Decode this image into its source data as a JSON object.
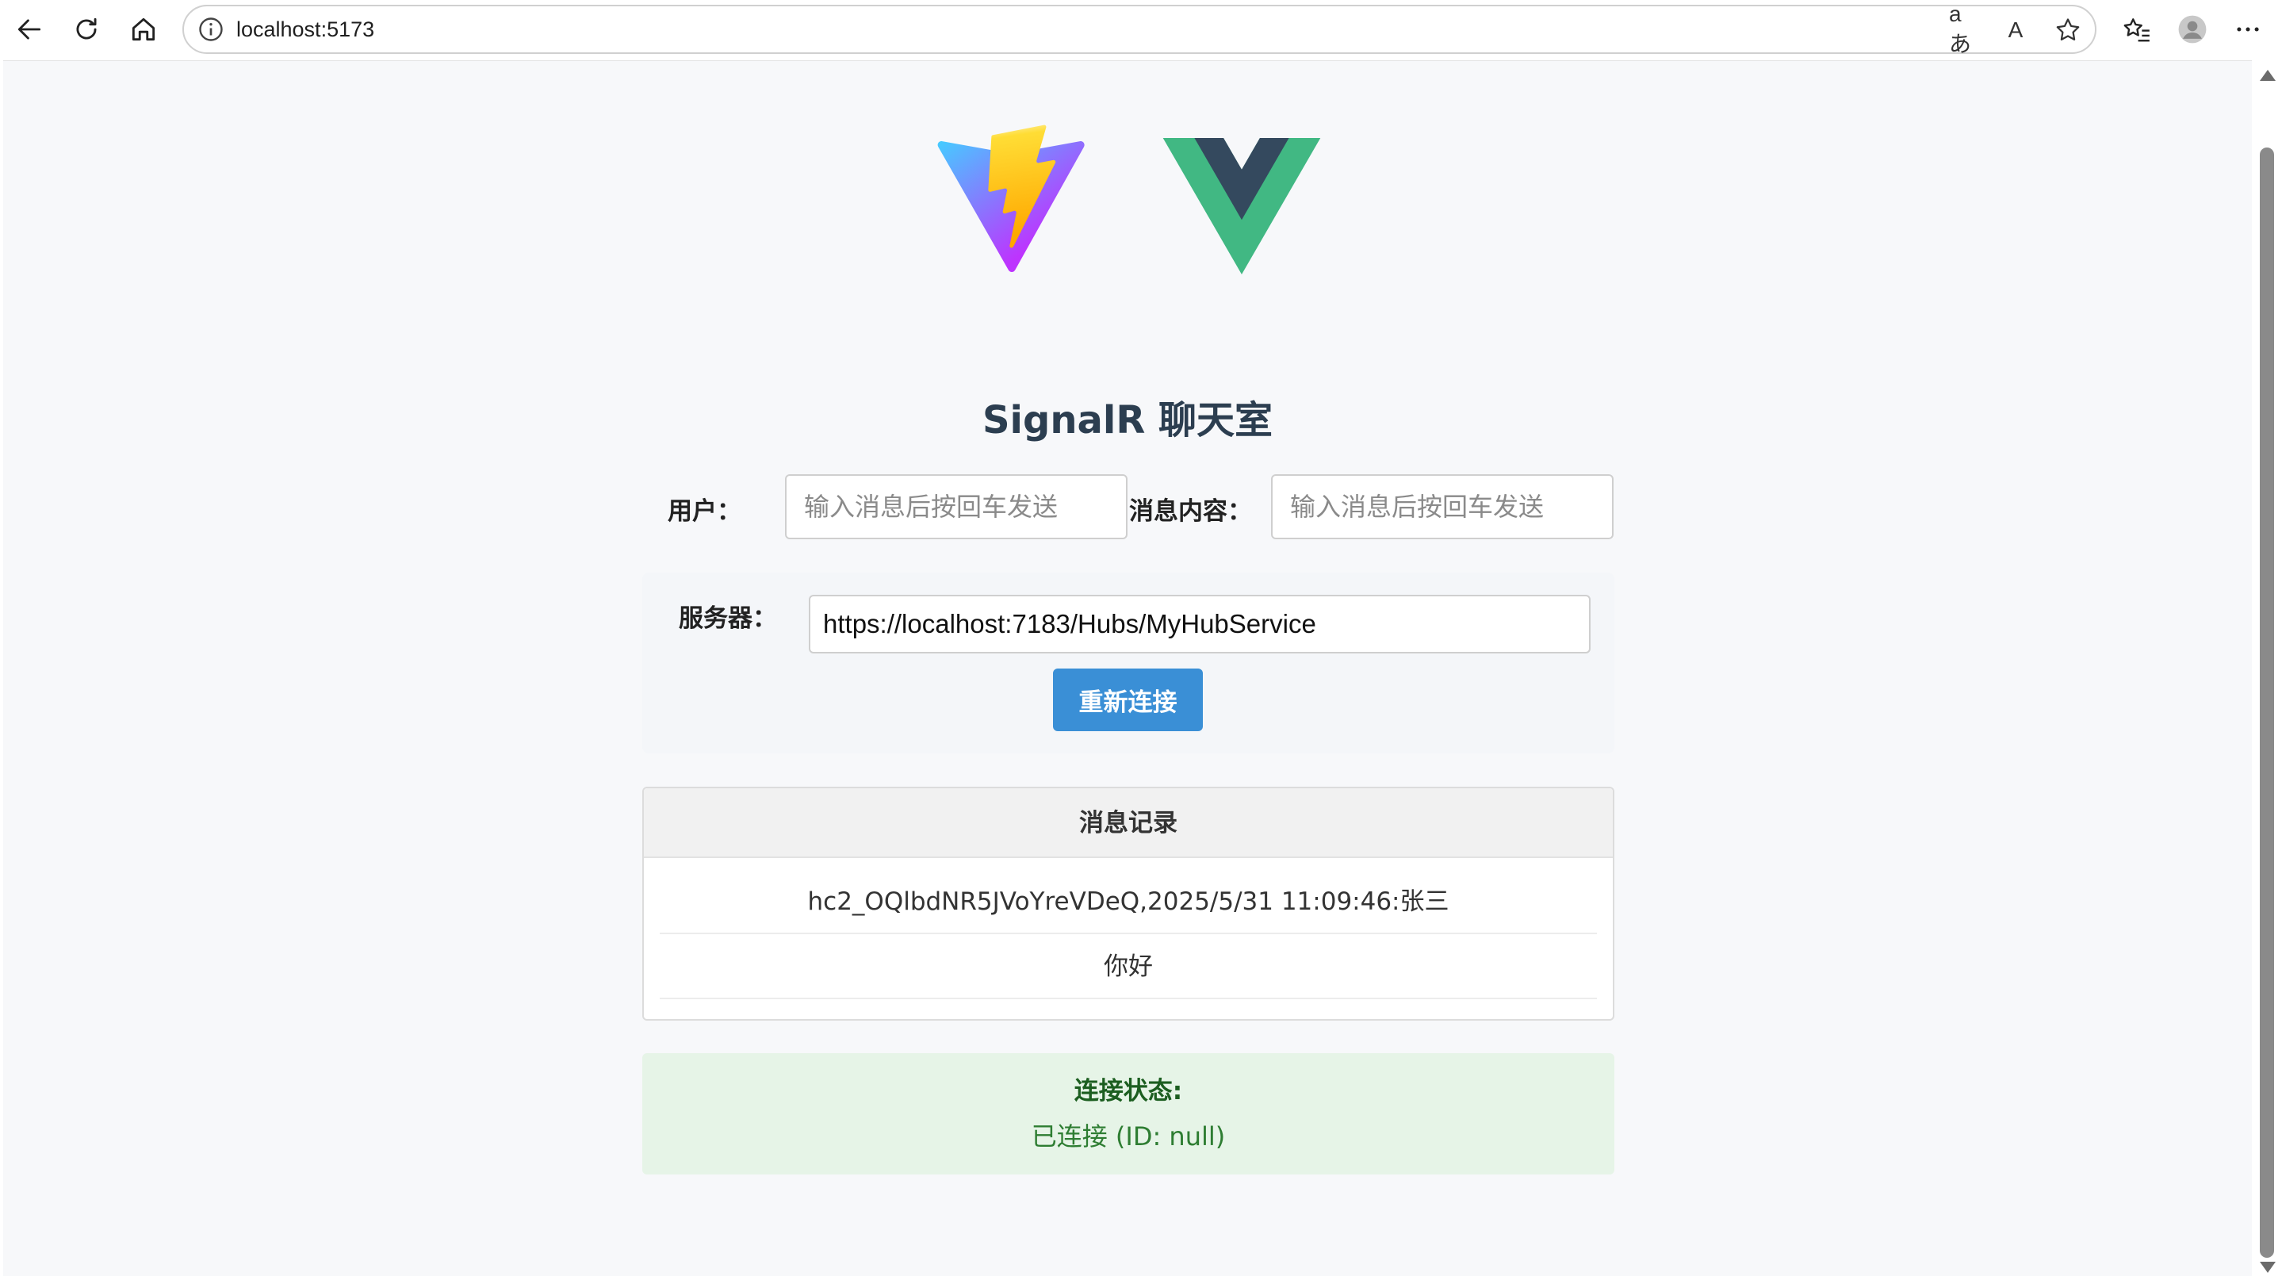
{
  "browser": {
    "url": "localhost:5173",
    "translate_glyph": "aあ",
    "read_aloud_glyph": "A"
  },
  "app": {
    "title": "SignalR 聊天室",
    "user_label": "用户：",
    "user_placeholder": "输入消息后按回车发送",
    "message_label": "消息内容：",
    "message_placeholder": "输入消息后按回车发送",
    "server_label": "服务器：",
    "server_value": "https://localhost:7183/Hubs/MyHubService",
    "reconnect_label": "重新连接"
  },
  "log": {
    "header": "消息记录",
    "lines": [
      "hc2_OQlbdNR5JVoYreVDeQ,2025/5/31 11:09:46:张三",
      "你好"
    ]
  },
  "status": {
    "label": "连接状态:",
    "value": "已连接 (ID: null)"
  },
  "colors": {
    "accent": "#3a8fd6",
    "status_bg": "#e6f4e7",
    "status_text": "#2e7d32",
    "vue_green": "#41b883",
    "vue_dark": "#34495e"
  }
}
